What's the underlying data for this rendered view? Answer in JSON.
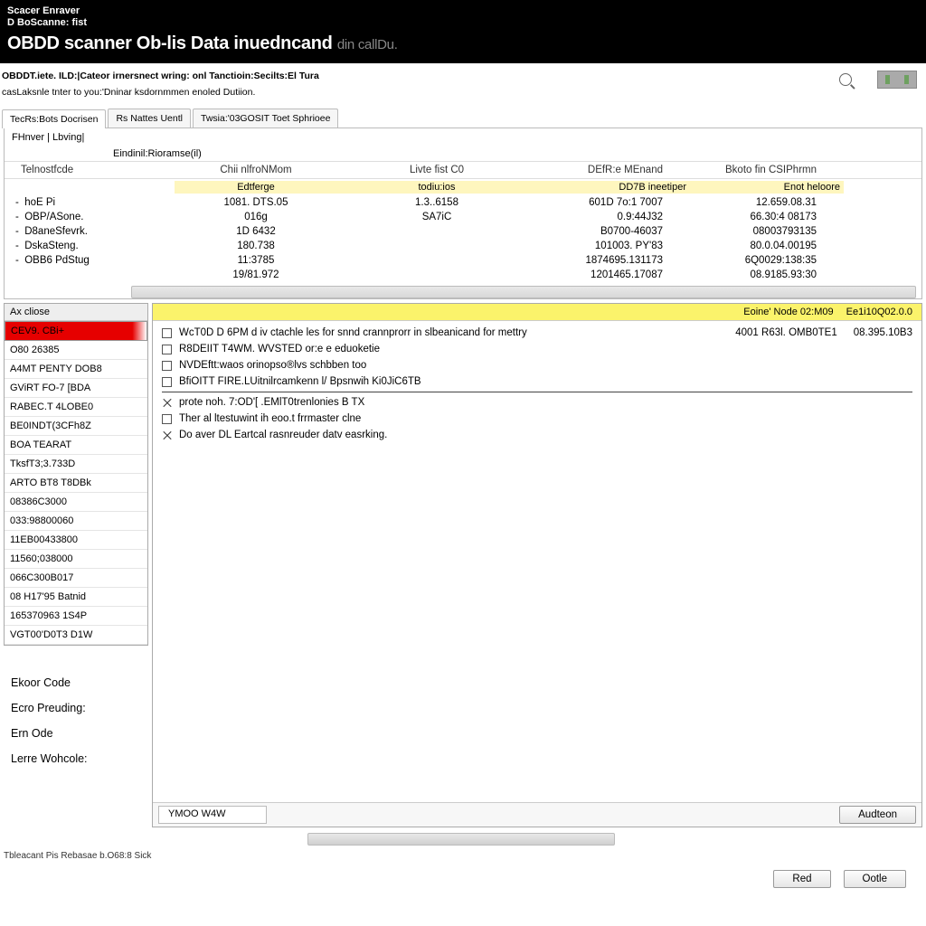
{
  "titlebar": {
    "line1": "Scacer Enraver",
    "line2": "D BoScanne: fist",
    "main_strong": "OBDD scanner Ob-lis Data inuedncand",
    "main_light": "din callDu."
  },
  "topbar": {
    "l1": "OBDDT.iete. ILD:|Cateor irnersnect wring: onl Tanctioin:Secilts:El Tura",
    "l2": "casLaksnle tnter to you:'Dninar ksdornmmen enoled Dutiion."
  },
  "tabs": [
    {
      "label": "TecRs:Bots Docrisen",
      "active": true
    },
    {
      "label": "Rs Nattes Uentl",
      "active": false
    },
    {
      "label": "Twsia:'03GOSIT Toet Sphrioee",
      "active": false
    }
  ],
  "section": {
    "left": "FHnver | Lbving|"
  },
  "summary_label": "Eindinil:Rioramse(il)",
  "table": {
    "headers": [
      "Telnostfcde",
      "Chii nlfroNMom",
      "Livte fist C0",
      "DEfR:e MEnand",
      "Bkoto fin CSIPhrmn"
    ],
    "subheaders": [
      "",
      "Edtferge",
      "todiu:ios",
      "DD7B ineetiper",
      "Enot heloore"
    ],
    "rows": [
      {
        "c1": "hoE Pi",
        "c2": "1081. DTS.05",
        "c3": "1.3..6158",
        "c4": "601D  7o:1 7007",
        "c5": "12.659.08.31"
      },
      {
        "c1": "OBP/ASone.",
        "c2": "016g",
        "c3": "SA7iC",
        "c4": "0.9:44J32",
        "c5": "66.30:4 08173"
      },
      {
        "c1": "D8aneSfevrk.",
        "c2": "1D 6432",
        "c3": "",
        "c4": "B0700-46037",
        "c5": "08003793135"
      },
      {
        "c1": "DskaSteng.",
        "c2": "180.738",
        "c3": "",
        "c4": "101003. PY'83",
        "c5": "80.0.04.00195"
      },
      {
        "c1": "OBB6 PdStug",
        "c2": "11:3785",
        "c3": "",
        "c4": "1874695.131173",
        "c5": "6Q0029:138:35"
      },
      {
        "c1": "",
        "c2": "19/81.972",
        "c3": "",
        "c4": "1201465.17087",
        "c5": "08.9185.93:30"
      }
    ]
  },
  "sidebar": {
    "header": "Ax cliose",
    "items": [
      {
        "label": "CEV9. CBi+",
        "selected": true
      },
      {
        "label": "O80 26385"
      },
      {
        "label": "A4MT PENTY DOB8"
      },
      {
        "label": "GViRT FO-7 [BDA"
      },
      {
        "label": "RABEC.T 4LOBE0"
      },
      {
        "label": "BE0INDT(3CFh8Z"
      },
      {
        "label": "BOA TEARAT"
      },
      {
        "label": "TksfT3;3.733D"
      },
      {
        "label": "ARTO BT8 T8DBk"
      },
      {
        "label": "08386C3000"
      },
      {
        "label": "033:98800060"
      },
      {
        "label": "11EB00433800"
      },
      {
        "label": "11560;038000"
      },
      {
        "label": "066C300B017"
      },
      {
        "label": "08 H17'95 Batnid"
      },
      {
        "label": "165370963 1S4P"
      },
      {
        "label": "VGT00'D0T3 D1W"
      }
    ],
    "labels": [
      "Ekoor Code",
      "Ecro Preuding:",
      "Ern Ode",
      "Lerre Wohcole:"
    ]
  },
  "detail": {
    "header": {
      "left": "Eoine' Node  02:M09",
      "right": "Ee1i10Q02.0.0"
    },
    "lines": [
      {
        "type": "cb",
        "text": "WcT0D D 6PM d iv ctachle les for snnd crannprorr in slbeanicand for mettry",
        "r1": "4001 R63l. OMB0TE1",
        "r2": "08.395.10B3"
      },
      {
        "type": "cb",
        "text": "R8DEIIT T4WM. WVSTED or:e e eduoketie"
      },
      {
        "type": "cb",
        "text": "NVDEftt:waos orinopso®lvs schbben too"
      },
      {
        "type": "cb",
        "text": "BfiOITT FIRE.LUitnilrcamkenn l/ Bpsnwih Ki0JiC6TB",
        "sep": true
      },
      {
        "type": "x",
        "text": "prote noh. 7:OD'[ .EMlT0trenlonies B TX"
      },
      {
        "type": "cb",
        "text": "Ther al ltestuwint ih eoo.t frrmaster clne"
      },
      {
        "type": "x",
        "text": "Do aver DL Eartcal rasnreuder datv easrking."
      }
    ],
    "footer_left": "YMOO W4W",
    "footer_btn": "Audteon"
  },
  "status": "Tbleacant Pis Rebasae b.O68:8 Sick",
  "bottom_buttons": {
    "left": "Red",
    "right": "Ootle"
  }
}
